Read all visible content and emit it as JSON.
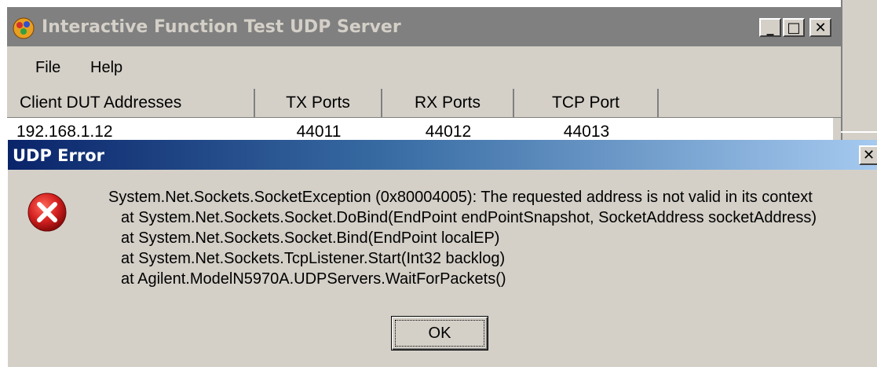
{
  "main_window": {
    "title": "Interactive Function Test UDP Server",
    "controls": {
      "minimize": "_",
      "maximize": "□",
      "close": "✕"
    },
    "menu": [
      {
        "label": "File"
      },
      {
        "label": "Help"
      }
    ],
    "grid": {
      "columns": [
        "Client DUT Addresses",
        "TX Ports",
        "RX Ports",
        "TCP Port"
      ],
      "rows": [
        [
          "192.168.1.12",
          "44011",
          "44012",
          "44013"
        ]
      ]
    }
  },
  "dialog": {
    "title": "UDP Error",
    "close": "✕",
    "icon": "error-icon",
    "message_lines": [
      "System.Net.Sockets.SocketException (0x80004005): The requested address is not valid in its context",
      "at System.Net.Sockets.Socket.DoBind(EndPoint endPointSnapshot, SocketAddress socketAddress)",
      "at System.Net.Sockets.Socket.Bind(EndPoint localEP)",
      "at System.Net.Sockets.TcpListener.Start(Int32 backlog)",
      "at Agilent.ModelN5970A.UDPServers.WaitForPackets()"
    ],
    "ok_label": "OK"
  },
  "colors": {
    "window_face": "#d4d0c8",
    "inactive_title": "#808080",
    "active_title_start": "#0a246a",
    "active_title_end": "#a6caf0",
    "error_red": "#d42020"
  }
}
